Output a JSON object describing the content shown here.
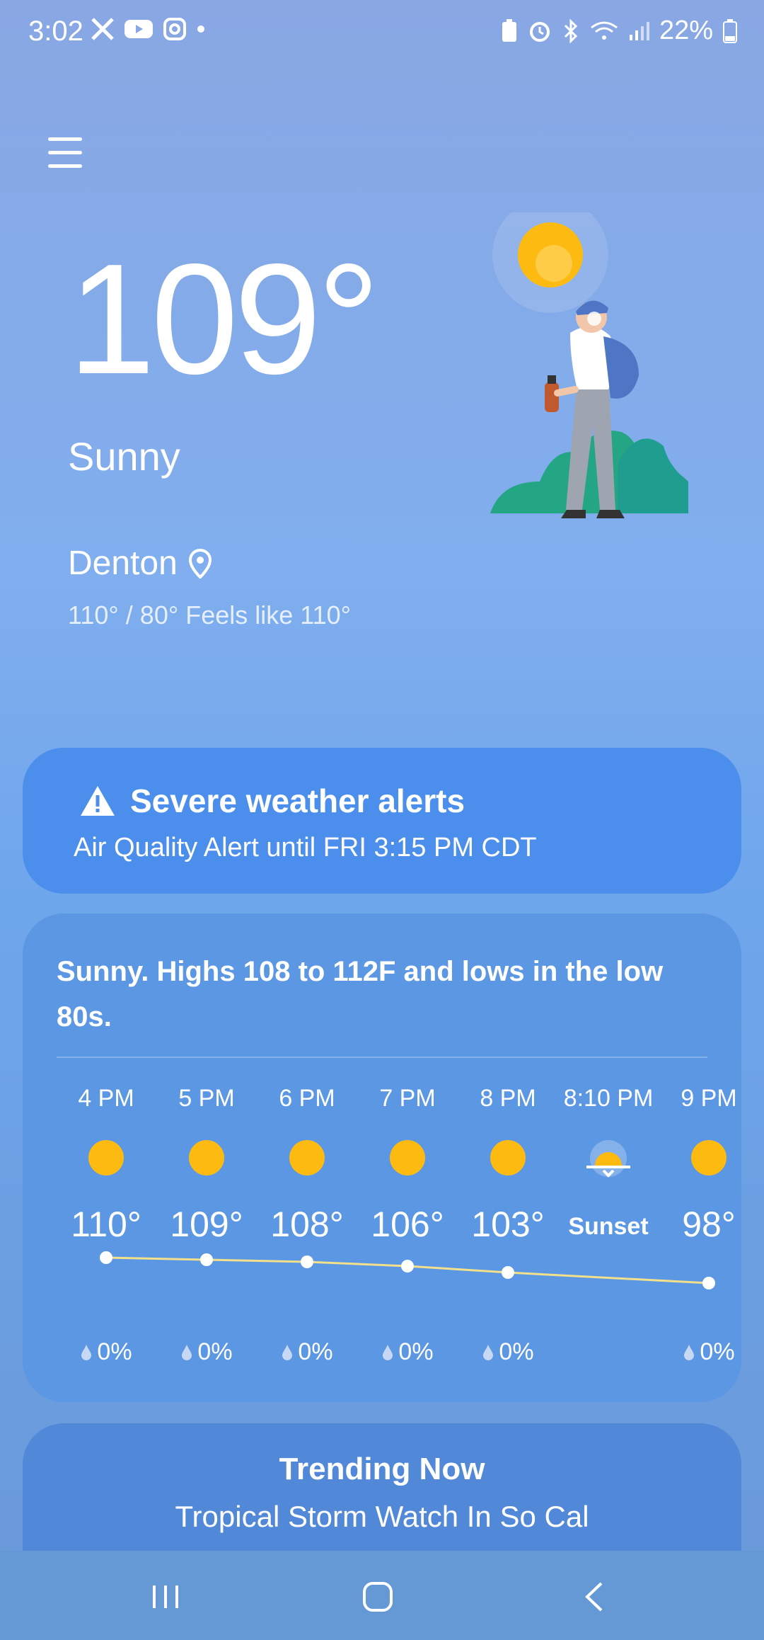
{
  "status_bar": {
    "time": "3:02",
    "battery_percent": "22%",
    "left_icons": [
      "x-icon",
      "youtube-icon",
      "instagram-icon",
      "dot-icon"
    ],
    "right_icons": [
      "battery-saver-icon",
      "alarm-icon",
      "bluetooth-icon",
      "wifi-icon",
      "signal-icon",
      "battery-icon"
    ]
  },
  "current": {
    "temperature": "109°",
    "condition": "Sunny",
    "location": "Denton",
    "hi_lo_feels": "110° / 80° Feels like 110°"
  },
  "alert": {
    "title": "Severe weather alerts",
    "subtitle": "Air Quality Alert until FRI 3:15 PM CDT"
  },
  "forecast": {
    "summary": "Sunny. Highs 108 to 112F and lows in the low 80s.",
    "hours": [
      {
        "time": "4 PM",
        "temp": "110°",
        "precip": "0%",
        "icon": "sun-icon",
        "temp_value": 110
      },
      {
        "time": "5 PM",
        "temp": "109°",
        "precip": "0%",
        "icon": "sun-icon",
        "temp_value": 109
      },
      {
        "time": "6 PM",
        "temp": "108°",
        "precip": "0%",
        "icon": "sun-icon",
        "temp_value": 108
      },
      {
        "time": "7 PM",
        "temp": "106°",
        "precip": "0%",
        "icon": "sun-icon",
        "temp_value": 106
      },
      {
        "time": "8 PM",
        "temp": "103°",
        "precip": "0%",
        "icon": "sun-icon",
        "temp_value": 103
      },
      {
        "time": "8:10 PM",
        "temp": "Sunset",
        "precip": "",
        "icon": "sunset-icon"
      },
      {
        "time": "9 PM",
        "temp": "98°",
        "precip": "0%",
        "icon": "sun-icon",
        "temp_value": 98
      }
    ]
  },
  "trending": {
    "title": "Trending Now",
    "subtitle": "Tropical Storm Watch In So Cal"
  },
  "colors": {
    "sun": "#fdbb12",
    "alert_card": "#4b8eec",
    "forecast_card": "#5c97e4",
    "temp_line": "#f2e08a"
  }
}
